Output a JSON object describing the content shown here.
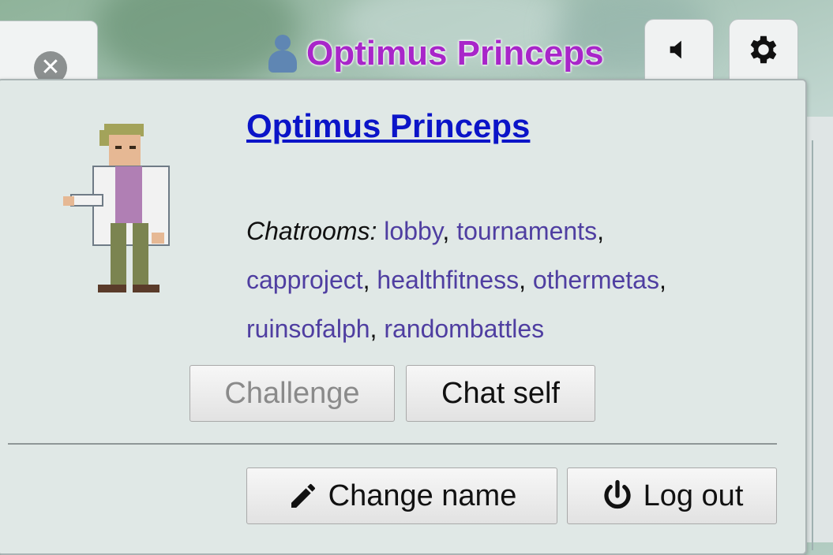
{
  "header": {
    "username": "Optimus Princeps",
    "sound_icon": "speaker-icon",
    "options_icon": "gear-icon",
    "name_color": "#a826c9"
  },
  "room_tab": {
    "close_icon": "close-circle-icon"
  },
  "profile": {
    "name": "Optimus Princeps",
    "avatar_icon": "trainer-sprite",
    "chatrooms_label": "Chatrooms:",
    "rooms": [
      "lobby",
      "tournaments",
      "capproject",
      "healthfitness",
      "othermetas",
      "ruinsofalph",
      "randombattles"
    ],
    "link_color": "#4f3ea1"
  },
  "actions": {
    "challenge": "Challenge",
    "chat_self": "Chat self",
    "change_name": "Change name",
    "log_out": "Log out",
    "change_name_icon": "pencil-icon",
    "log_out_icon": "power-icon"
  }
}
